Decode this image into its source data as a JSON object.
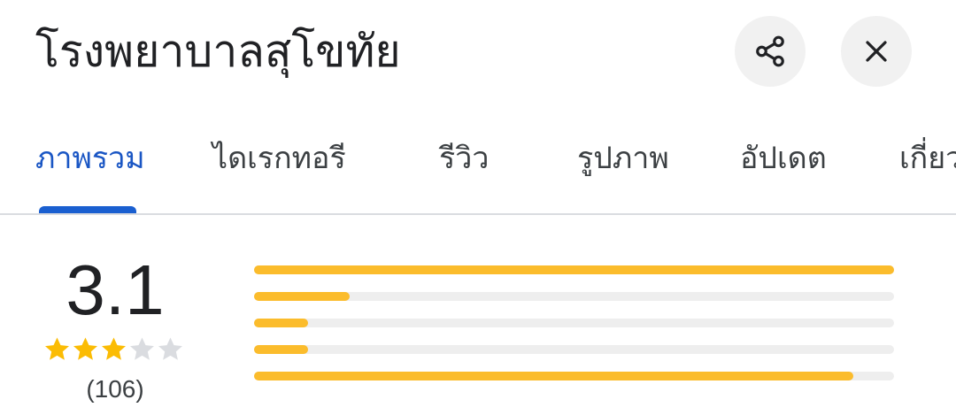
{
  "header": {
    "title": "โรงพยาบาลสุโขทัย",
    "share_icon": "share-icon",
    "close_icon": "close-icon"
  },
  "tabs": [
    {
      "label": "ภาพรวม",
      "active": true
    },
    {
      "label": "ไดเรกทอรี",
      "active": false
    },
    {
      "label": "รีวิว",
      "active": false
    },
    {
      "label": "รูปภาพ",
      "active": false
    },
    {
      "label": "อัปเดต",
      "active": false
    },
    {
      "label": "เกี่ยว",
      "active": false
    }
  ],
  "rating": {
    "score": "3.1",
    "stars_filled": 3,
    "stars_total": 5,
    "count": "(106)",
    "distribution": [
      1.0,
      0.15,
      0.085,
      0.085,
      0.937
    ]
  },
  "colors": {
    "accent": "#1a5fd0",
    "star": "#fbbc04",
    "bar_fill": "#fbbc2c",
    "bar_track": "#eeeeee"
  }
}
